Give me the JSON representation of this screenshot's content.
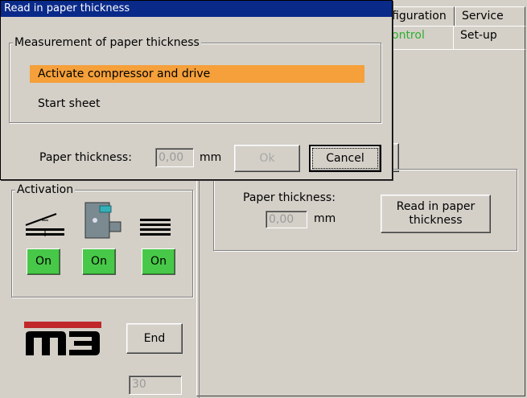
{
  "tabs": {
    "row1": [
      "figuration",
      "Service"
    ],
    "row2": [
      "ontrol",
      "Set-up"
    ]
  },
  "dialog": {
    "title": "Read in paper thickness",
    "group_title": "Measurement of paper thickness",
    "options": [
      "Activate compressor and drive",
      "Start sheet"
    ],
    "thickness_label": "Paper thickness:",
    "thickness_value": "0,00",
    "unit": "mm",
    "ok_label": "Ok",
    "cancel_label": "Cancel"
  },
  "activation": {
    "title": "Activation",
    "buttons": [
      "On",
      "On",
      "On"
    ],
    "on_color": "#48c848"
  },
  "main": {
    "thickness_label": "Paper thickness:",
    "thickness_value": "0,00",
    "unit": "mm",
    "read_button": "Read in paper\nthickness"
  },
  "footer": {
    "logo_text": "m3",
    "end_label": "End",
    "counter_value": "30"
  }
}
